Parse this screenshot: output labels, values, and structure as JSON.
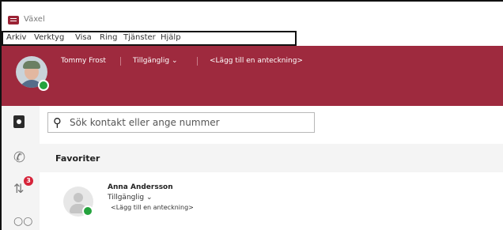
{
  "window": {
    "title": "Växel"
  },
  "menu": [
    "Arkiv",
    "Verktyg",
    "Visa",
    "Ring",
    "Tjänster",
    "Hjälp"
  ],
  "header": {
    "user_name": "Tommy Frost",
    "status": "Tillgänglig ⌄",
    "note_placeholder": "<Lägg till en anteckning>"
  },
  "colors": {
    "header": "#9e2a3e",
    "status_available": "#25a33e",
    "badge": "#d6243a"
  },
  "rail": {
    "icons": [
      "contacts-book-icon",
      "phone-icon",
      "call-history-icon",
      "voicemail-icon"
    ],
    "badge_count": "3"
  },
  "search": {
    "placeholder": "Sök kontakt eller ange nummer"
  },
  "favorites": {
    "title": "Favoriter",
    "contacts": [
      {
        "name": "Anna Andersson",
        "status": "Tillgänglig ⌄",
        "note": "<Lägg till en anteckning>"
      }
    ]
  }
}
